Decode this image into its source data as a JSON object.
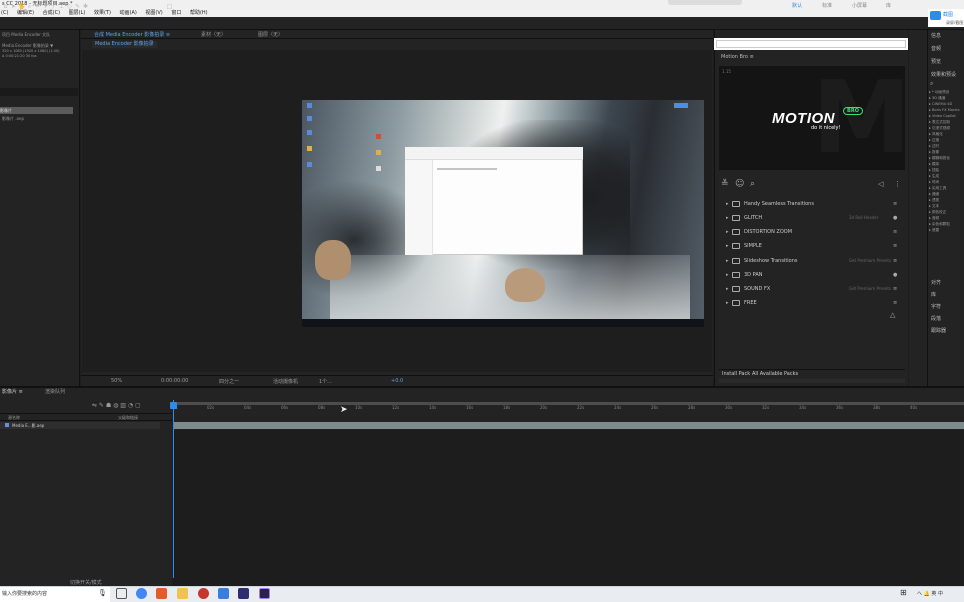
{
  "window": {
    "title": "s CC 2018 - 无标题项目.aep *"
  },
  "menu": [
    "(C)",
    "编辑(E)",
    "合成(C)",
    "图层(L)",
    "效果(T)",
    "动画(A)",
    "视图(V)",
    "窗口",
    "帮助(H)"
  ],
  "toolbar": {
    "workspaces": [
      "默认",
      "标准",
      "小屏幕",
      "库"
    ],
    "active_workspace": "默认",
    "ext_button_label": "截图",
    "ext_button_sub": "录屏/截图"
  },
  "project_panel": {
    "title": "项目 Media Encoder 文队",
    "info_lines": [
      "Media Encoder 影像拍录 ▼",
      "320 x 1080 (1920 x 1080) (1.00)",
      "Δ 0:00:21:20 30 fps"
    ],
    "selected_item": "影像片",
    "list_item": "影像片 .aep"
  },
  "comp_panel": {
    "tabs": [
      "合成 Media Encoder 影像拍录 ≡",
      "素材（无）",
      "图层（无）"
    ],
    "active_subtab": "Media Encoder 影像拍录",
    "viewer_bar": [
      "50%",
      "0:00:00:00",
      "四分之一",
      "活动摄像机",
      "1个...",
      "+0.0"
    ]
  },
  "motion_bro": {
    "panel_title": "Motion Bro ≡",
    "version": "1.15",
    "logo": "MOTION",
    "badge": "BRO",
    "tagline": "do it nicely!",
    "packs": [
      {
        "name": "Handy Seamless Transitions",
        "sub": "",
        "marker": "≡"
      },
      {
        "name": "GLITCH",
        "sub": "3d Roll Header",
        "marker": "●"
      },
      {
        "name": "DISTORTION ZOOM",
        "sub": "",
        "marker": "≡"
      },
      {
        "name": "SIMPLE",
        "sub": "",
        "marker": "≡"
      },
      {
        "name": "Slideshow Transitions",
        "sub": "Get Premium Presets",
        "marker": "≡"
      },
      {
        "name": "3D PAN",
        "sub": "",
        "marker": "●"
      },
      {
        "name": "SOUND FX",
        "sub": "Get Premium Presets",
        "marker": "≡"
      },
      {
        "name": "FREE",
        "sub": "",
        "marker": "≡"
      }
    ],
    "footer_install": "Install Pack",
    "footer_all": "All Available Packs"
  },
  "effects_panel": {
    "headers": [
      "信息",
      "音频",
      "预览",
      "效果和预设"
    ],
    "list": [
      "▸ * 动画预设",
      "▸ 3D 通道",
      "▸ CINEMA 4D",
      "▸ Boris FX Mocha",
      "▸ Video Copilot",
      "▸ 表达式控制",
      "▸ 沉浸式视频",
      "▸ 风格化",
      "▸ 过渡",
      "▸ 过时",
      "▸ 抠像",
      "▸ 模糊和锐化",
      "▸ 模拟",
      "▸ 扭曲",
      "▸ 生成",
      "▸ 时间",
      "▸ 实用工具",
      "▸ 通道",
      "▸ 透视",
      "▸ 文本",
      "▸ 颜色校正",
      "▸ 音频",
      "▸ 杂色和颗粒",
      "▸ 遮罩"
    ],
    "more": [
      "对齐",
      "库",
      "字符",
      "段落",
      "跟踪器"
    ]
  },
  "timeline": {
    "tabs": [
      "影像片 ≡",
      "渲染队列"
    ],
    "columns": "源名称",
    "columns_right": "父级和链接",
    "layer": "Media E...影.aep",
    "ticks": [
      "0s",
      "02s",
      "04s",
      "06s",
      "08s",
      "10s",
      "12s",
      "14s",
      "16s",
      "18s",
      "20s",
      "22s",
      "24s",
      "26s",
      "28s",
      "30s",
      "32s",
      "34s",
      "36s",
      "38s",
      "40s"
    ],
    "footer": "切换开关/模式"
  },
  "taskbar": {
    "search_placeholder": "输入你要搜索的内容",
    "tray": "へ 🔔 英 中"
  }
}
